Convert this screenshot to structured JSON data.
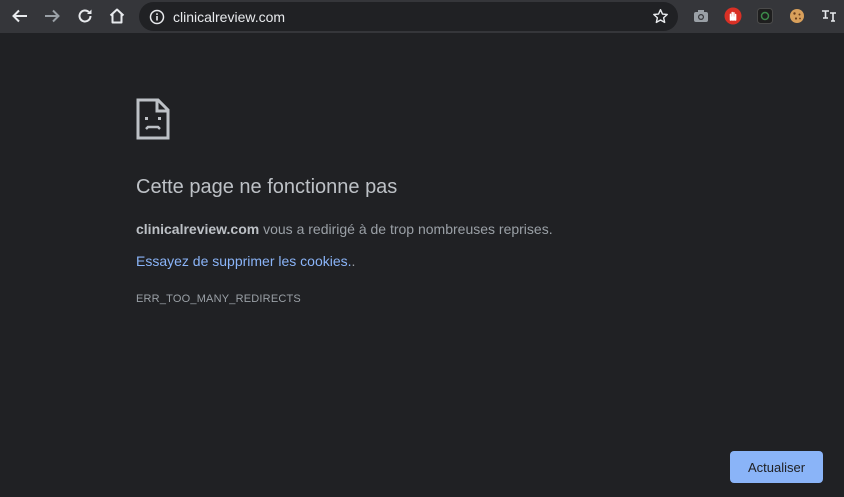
{
  "toolbar": {
    "url": "clinicalreview.com",
    "icons": [
      "back-icon",
      "forward-icon",
      "reload-icon",
      "home-icon",
      "info-icon",
      "star-icon"
    ],
    "extensions": [
      "camera-extension-icon",
      "hand-stop-extension-icon",
      "dark-square-extension-icon",
      "cookie-extension-icon",
      "translate-extension-icon"
    ]
  },
  "error": {
    "icon": "sad-page-icon",
    "title": "Cette page ne fonctionne pas",
    "domain": "clinicalreview.com",
    "description": " vous a redirigé à de trop nombreuses reprises.",
    "suggestion_link": "Essayez de supprimer les cookies.",
    "suggestion_suffix": ".",
    "code": "ERR_TOO_MANY_REDIRECTS",
    "reload_label": "Actualiser"
  },
  "colors": {
    "background": "#202124",
    "toolbar": "#35363a",
    "link": "#8ab4f8",
    "button": "#8ab4f8"
  }
}
